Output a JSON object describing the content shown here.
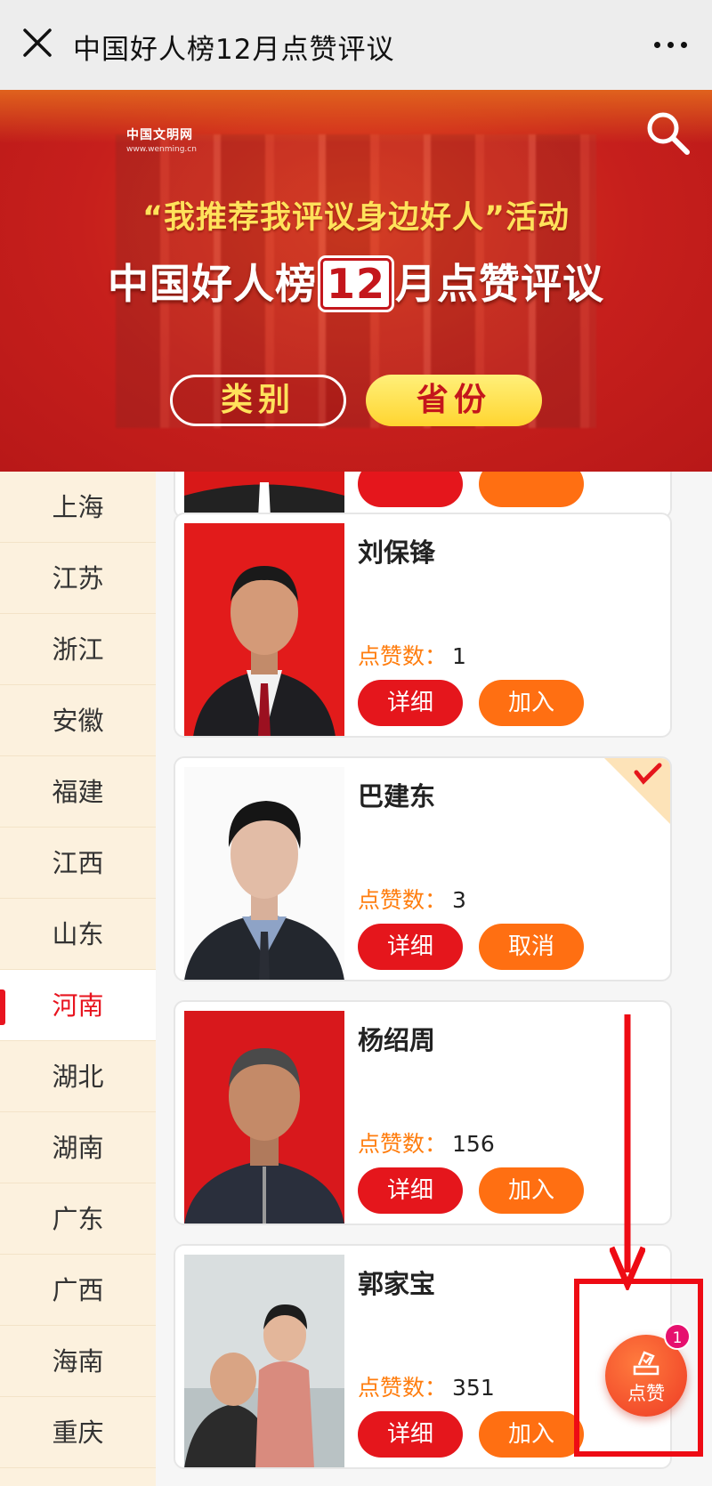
{
  "header": {
    "title": "中国好人榜12月点赞评议"
  },
  "banner": {
    "logo_text": "中国文明网",
    "logo_sub": "www.wenming.cn",
    "slogan": "“我推荐我评议身边好人”活动",
    "headline_prefix": "中国好人榜",
    "headline_month": "12",
    "headline_suffix": "月点赞评议",
    "category_button": "类别",
    "province_button": "省份"
  },
  "sidebar": {
    "items": [
      "上海",
      "江苏",
      "浙江",
      "安徽",
      "福建",
      "江西",
      "山东",
      "河南",
      "湖北",
      "湖南",
      "广东",
      "广西",
      "海南",
      "重庆"
    ],
    "active": "河南"
  },
  "cards": [
    {
      "name": "刘保锋",
      "likes_label": "点赞数：",
      "likes": "1",
      "detail_label": "详细",
      "action_label": "加入",
      "selected": false
    },
    {
      "name": "巴建东",
      "likes_label": "点赞数：",
      "likes": "3",
      "detail_label": "详细",
      "action_label": "取消",
      "selected": true
    },
    {
      "name": "杨绍周",
      "likes_label": "点赞数：",
      "likes": "156",
      "detail_label": "详细",
      "action_label": "加入",
      "selected": false
    },
    {
      "name": "郭家宝",
      "likes_label": "点赞数：",
      "likes": "351",
      "detail_label": "详细",
      "action_label": "加入",
      "selected": false
    }
  ],
  "fab": {
    "label": "点赞",
    "badge": "1"
  },
  "colors": {
    "primary_red": "#e5161c",
    "orange": "#ff6f12",
    "annotation": "#ee0b14"
  }
}
